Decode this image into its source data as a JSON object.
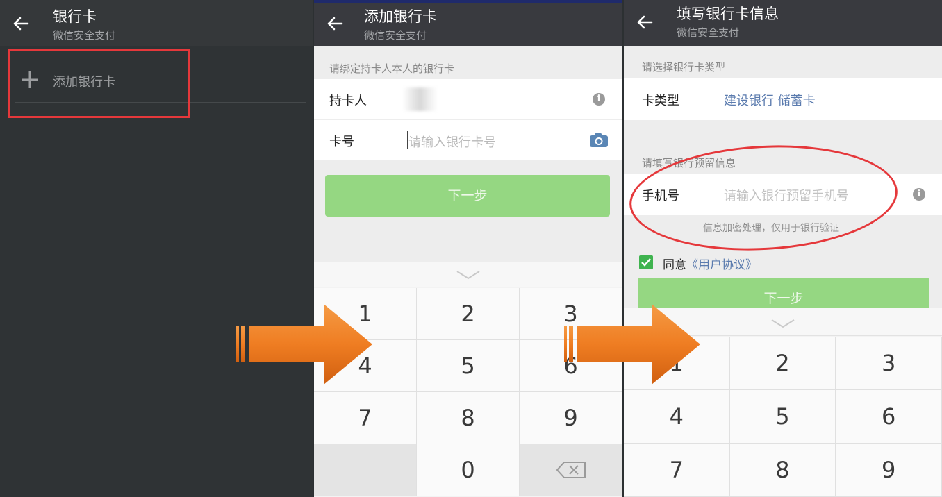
{
  "screen1": {
    "title": "银行卡",
    "subtitle": "微信安全支付",
    "add_card_label": "添加银行卡"
  },
  "screen2": {
    "title": "添加银行卡",
    "subtitle": "微信安全支付",
    "section_label": "请绑定持卡人本人的银行卡",
    "cardholder_label": "持卡人",
    "cardno_label": "卡号",
    "cardno_placeholder": "请输入银行卡号",
    "next_label": "下一步",
    "keys": [
      "1",
      "2",
      "3",
      "4",
      "5",
      "6",
      "7",
      "8",
      "9",
      "",
      "0",
      "backspace"
    ]
  },
  "screen3": {
    "title": "填写银行卡信息",
    "subtitle": "微信安全支付",
    "section1_label": "请选择银行卡类型",
    "card_type_label": "卡类型",
    "card_type_value": "建设银行 储蓄卡",
    "section2_label": "请填写银行预留信息",
    "phone_label": "手机号",
    "phone_placeholder": "请输入银行预留手机号",
    "phone_note": "信息加密处理，仅用于银行验证",
    "agree_text": "同意",
    "agreement_link": "《用户协议》",
    "next_label": "下一步",
    "keys": [
      "1",
      "2",
      "3",
      "4",
      "5",
      "6",
      "7",
      "8",
      "9"
    ]
  },
  "colors": {
    "highlight": "#e5383b",
    "button_green": "#95d782",
    "arrow_orange": "#ef7d22",
    "link_blue": "#5b7bae"
  }
}
